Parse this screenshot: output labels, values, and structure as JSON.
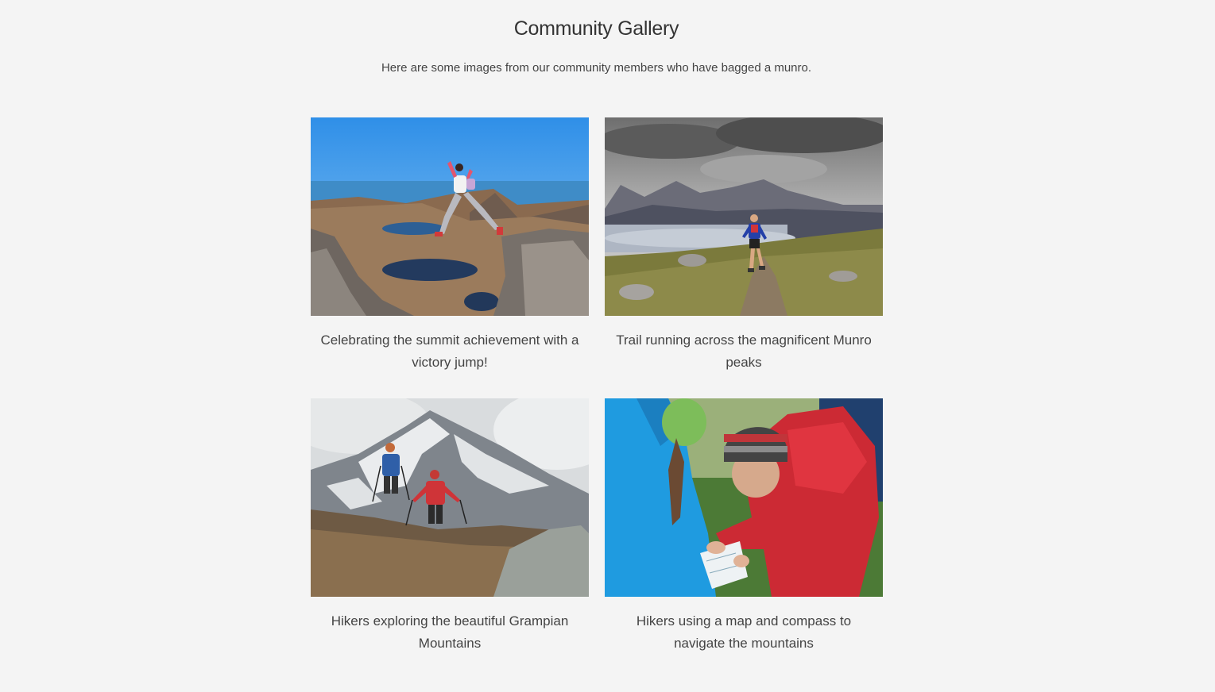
{
  "gallery": {
    "title": "Community Gallery",
    "subtitle": "Here are some images from our community members who have bagged a munro.",
    "items": [
      {
        "caption": "Celebrating the summit achievement with a victory jump!"
      },
      {
        "caption": "Trail running across the magnificent Munro peaks"
      },
      {
        "caption": "Hikers exploring the beautiful Grampian Mountains"
      },
      {
        "caption": "Hikers using a map and compass to navigate the mountains"
      }
    ]
  }
}
